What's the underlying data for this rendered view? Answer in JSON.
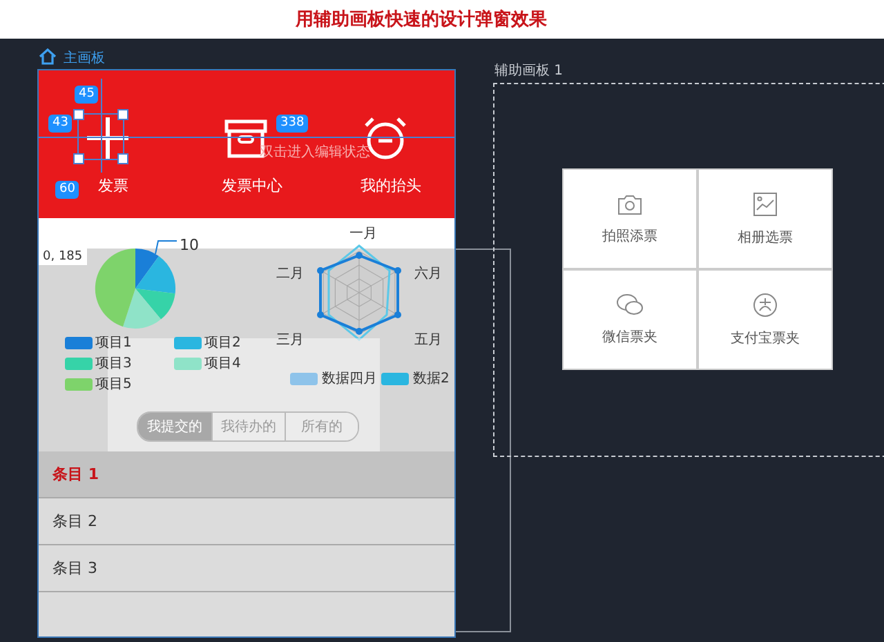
{
  "title": "用辅助画板快速的设计弹窗效果",
  "main_artboard": {
    "label": "主画板",
    "header": {
      "items": [
        {
          "label": "发票"
        },
        {
          "label": "发票中心"
        },
        {
          "label": "我的抬头"
        }
      ],
      "badges": [
        "45",
        "43",
        "338",
        "60"
      ],
      "hint": "双击进入编辑状态"
    },
    "coordinate": "0, 185",
    "pie": {
      "value_label": "10",
      "legend": [
        {
          "label": "项目1",
          "color": "#1a7fd8"
        },
        {
          "label": "项目2",
          "color": "#2ab6e0"
        },
        {
          "label": "项目3",
          "color": "#36d3a8"
        },
        {
          "label": "项目4",
          "color": "#8fe3c8"
        },
        {
          "label": "项目5",
          "color": "#7ed36b"
        }
      ]
    },
    "radar": {
      "axes": [
        "一月",
        "六月",
        "五月",
        "三月",
        "二月"
      ],
      "legend": [
        {
          "label": "数据四月",
          "color": "#8ec3ea"
        },
        {
          "label": "数据2",
          "color": "#2ab6e0"
        }
      ]
    },
    "segments": [
      {
        "label": "我提交的",
        "selected": true
      },
      {
        "label": "我待办的",
        "selected": false
      },
      {
        "label": "所有的",
        "selected": false
      }
    ],
    "list": [
      {
        "label": "条目 1",
        "selected": true
      },
      {
        "label": "条目 2",
        "selected": false
      },
      {
        "label": "条目 3",
        "selected": false
      }
    ]
  },
  "aux_artboard": {
    "label": "辅助画板 1",
    "tiles": [
      {
        "label": "拍照添票",
        "kind": "camera"
      },
      {
        "label": "相册选票",
        "kind": "image"
      },
      {
        "label": "微信票夹",
        "kind": "chat"
      },
      {
        "label": "支付宝票夹",
        "kind": "alipay"
      }
    ]
  }
}
